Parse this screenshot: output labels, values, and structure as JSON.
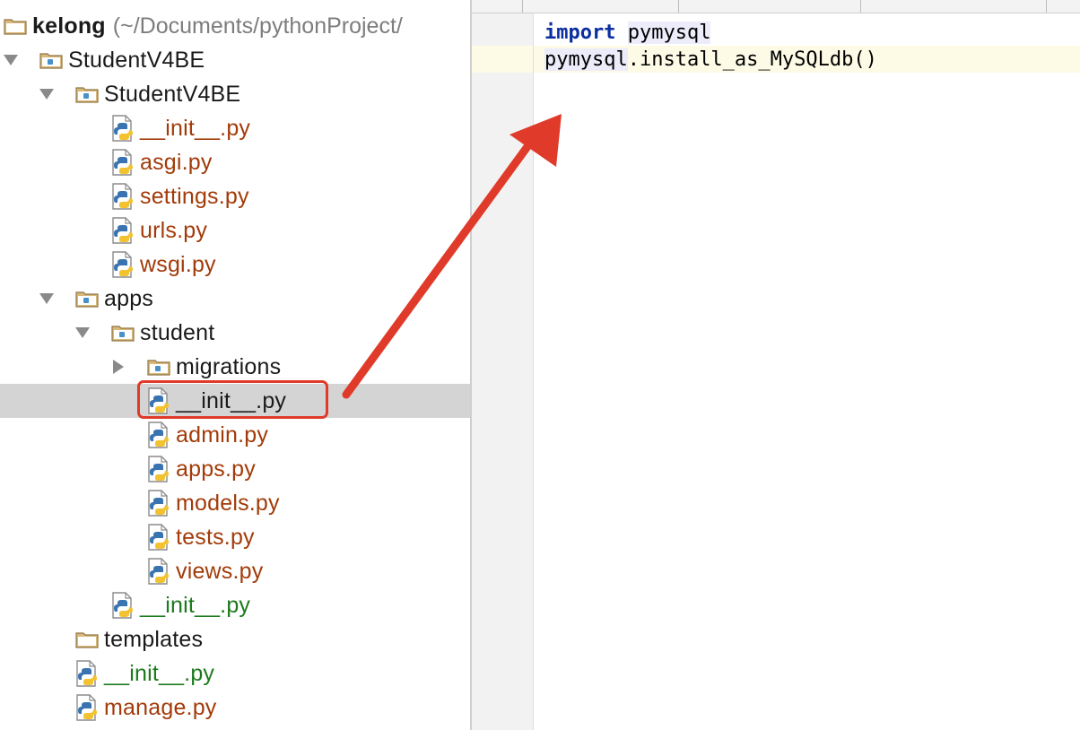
{
  "tree": {
    "root": {
      "name": "kelong",
      "path": "(~/Documents/pythonProject/"
    },
    "items": [
      {
        "label": "StudentV4BE",
        "kind": "module-folder",
        "depth": 1,
        "arrow": "down",
        "color": "default"
      },
      {
        "label": "StudentV4BE",
        "kind": "module-folder",
        "depth": 2,
        "arrow": "down",
        "color": "default"
      },
      {
        "label": "__init__.py",
        "kind": "py",
        "depth": 3,
        "color": "red"
      },
      {
        "label": "asgi.py",
        "kind": "py",
        "depth": 3,
        "color": "red"
      },
      {
        "label": "settings.py",
        "kind": "py",
        "depth": 3,
        "color": "red"
      },
      {
        "label": "urls.py",
        "kind": "py",
        "depth": 3,
        "color": "red"
      },
      {
        "label": "wsgi.py",
        "kind": "py",
        "depth": 3,
        "color": "red"
      },
      {
        "label": "apps",
        "kind": "module-folder",
        "depth": 2,
        "arrow": "down",
        "color": "default"
      },
      {
        "label": "student",
        "kind": "module-folder",
        "depth": 3,
        "arrow": "down",
        "color": "default"
      },
      {
        "label": "migrations",
        "kind": "module-folder",
        "depth": 4,
        "arrow": "right",
        "color": "default"
      },
      {
        "label": "__init__.py",
        "kind": "py",
        "depth": 4,
        "color": "default",
        "selected": true
      },
      {
        "label": "admin.py",
        "kind": "py",
        "depth": 4,
        "color": "red"
      },
      {
        "label": "apps.py",
        "kind": "py",
        "depth": 4,
        "color": "red"
      },
      {
        "label": "models.py",
        "kind": "py",
        "depth": 4,
        "color": "red"
      },
      {
        "label": "tests.py",
        "kind": "py",
        "depth": 4,
        "color": "red"
      },
      {
        "label": "views.py",
        "kind": "py",
        "depth": 4,
        "color": "red"
      },
      {
        "label": "__init__.py",
        "kind": "py",
        "depth": 3,
        "color": "green"
      },
      {
        "label": "templates",
        "kind": "folder",
        "depth": 2,
        "color": "default"
      },
      {
        "label": "__init__.py",
        "kind": "py",
        "depth": 2,
        "color": "green"
      },
      {
        "label": "manage.py",
        "kind": "py",
        "depth": 2,
        "color": "red"
      }
    ]
  },
  "editor": {
    "lines": [
      {
        "keyword": "import",
        "rest": " ",
        "module": "pymysql"
      },
      {
        "module": "pymysql",
        "rest": ".install_as_MySQLdb()"
      }
    ]
  },
  "annotation": {
    "color": "#e03a2a"
  },
  "colors": {
    "file_modified": "#a23b09",
    "file_added": "#1b7a1b",
    "selection": "#d4d4d4",
    "keyword": "#0b2fa0",
    "current_line": "#fdfbe6"
  }
}
